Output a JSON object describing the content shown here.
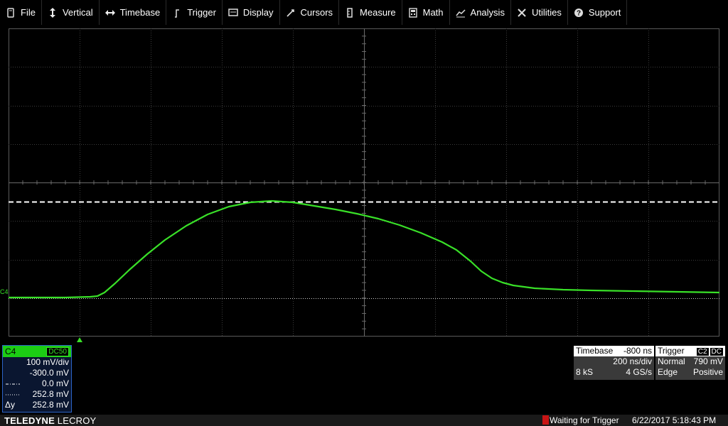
{
  "menu": {
    "items": [
      {
        "key": "file",
        "label": "File",
        "icon": "file-icon"
      },
      {
        "key": "vertical",
        "label": "Vertical",
        "icon": "vertical-arrow-icon"
      },
      {
        "key": "timebase",
        "label": "Timebase",
        "icon": "horizontal-arrow-icon"
      },
      {
        "key": "trigger",
        "label": "Trigger",
        "icon": "trigger-icon"
      },
      {
        "key": "display",
        "label": "Display",
        "icon": "display-icon"
      },
      {
        "key": "cursors",
        "label": "Cursors",
        "icon": "cursors-icon"
      },
      {
        "key": "measure",
        "label": "Measure",
        "icon": "measure-icon"
      },
      {
        "key": "math",
        "label": "Math",
        "icon": "math-icon"
      },
      {
        "key": "analysis",
        "label": "Analysis",
        "icon": "analysis-icon"
      },
      {
        "key": "utilities",
        "label": "Utilities",
        "icon": "utilities-icon"
      },
      {
        "key": "support",
        "label": "Support",
        "icon": "support-icon"
      }
    ]
  },
  "grid": {
    "channel_marker": "C4",
    "trace_color": "#39e028",
    "cursor_color": "#ffffff",
    "graticule_color": "#5a5a5a"
  },
  "channel": {
    "name": "C4",
    "coupling": "DC50",
    "vdiv": "100 mV/div",
    "offset": "-300.0 mV",
    "cursor1": "0.0 mV",
    "cursor2": "252.8 mV",
    "delta_label": "Δy",
    "delta": "252.8 mV",
    "color": "#1ccd14"
  },
  "timebase": {
    "title": "Timebase",
    "delay": "-800 ns",
    "tdiv": "200 ns/div",
    "samples": "8 kS",
    "rate": "4 GS/s"
  },
  "trigger": {
    "title": "Trigger",
    "source": "C2",
    "coupling": "DC",
    "mode": "Normal",
    "level": "790 mV",
    "type": "Edge",
    "slope": "Positive"
  },
  "status": {
    "brand_bold": "TELEDYNE",
    "brand_rest": " LECROY",
    "message": "Waiting for Trigger",
    "datetime": "6/22/2017 5:18:43 PM"
  }
}
